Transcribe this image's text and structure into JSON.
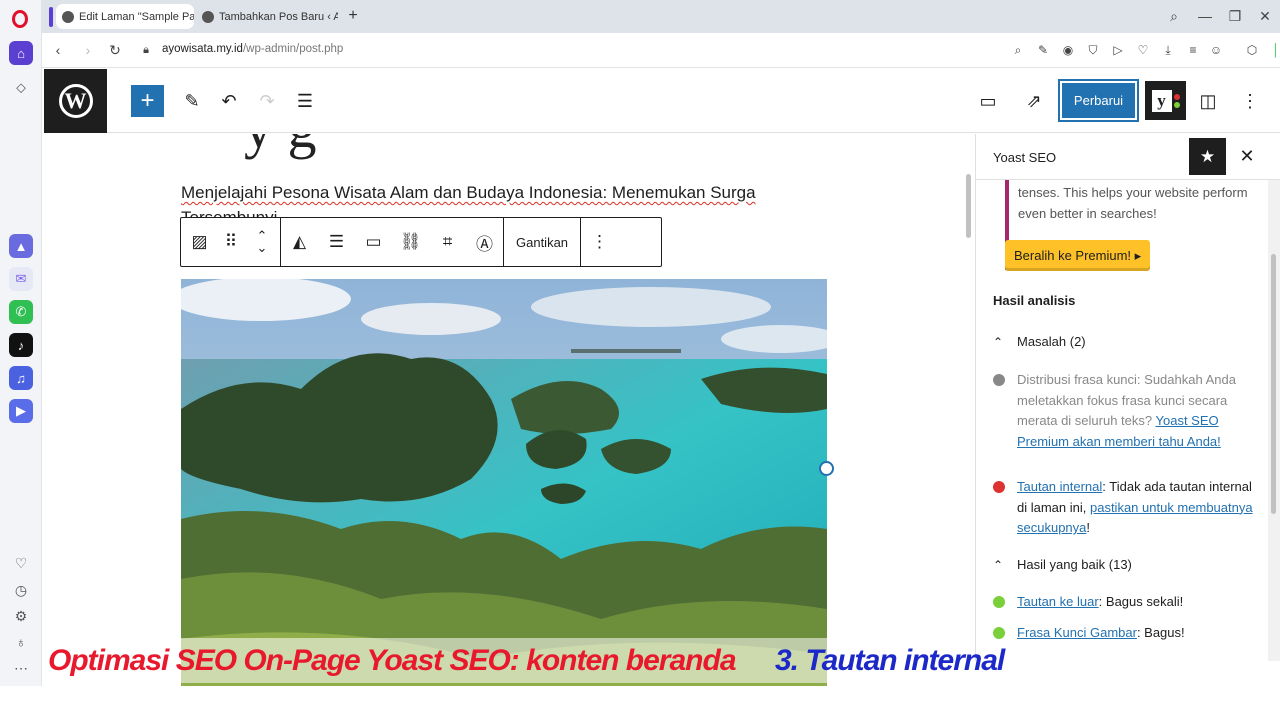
{
  "browser": {
    "tabs": [
      {
        "label": "Edit Laman \"Sample Page",
        "active": true
      },
      {
        "label": "Tambahkan Pos Baru ‹ Ayo",
        "active": false
      }
    ],
    "new_tab_icon": "plus-icon",
    "url_domain": "ayowisata.my.id",
    "url_path": "/wp-admin/post.php"
  },
  "editor": {
    "partial_heading": "y g",
    "paragraph": "Menjelajahi Pesona Wisata Alam dan Budaya Indonesia: Menemukan Surga Tersembunyi",
    "block_toolbar": {
      "replace_label": "Gantikan"
    },
    "image_alt": "Pemandangan pulau-pulau karst di laut biru kehijauan"
  },
  "toolbar": {
    "update_label": "Perbarui",
    "yoast_letter": "y"
  },
  "sidebar": {
    "title": "Yoast SEO",
    "premium_text": "tenses. This helps your website perform even better in searches!",
    "premium_button": "Beralih ke Premium! ▸",
    "analysis_title": "Hasil analisis",
    "problems_heading": "Masalah (2)",
    "problems": [
      {
        "status": "gray",
        "text": "Distribusi frasa kunci: Sudahkah Anda meletakkan fokus frasa kunci secara merata di seluruh teks? ",
        "link": "Yoast SEO Premium akan memberi tahu Anda!"
      },
      {
        "status": "red",
        "link": "Tautan internal",
        "text": ": Tidak ada tautan internal di laman ini, ",
        "link2": "pastikan untuk membuatnya secukupnya",
        "tail": "!"
      }
    ],
    "good_heading": "Hasil yang baik (13)",
    "good": [
      {
        "link": "Tautan ke luar",
        "text": ": Bagus sekali!"
      },
      {
        "link": "Frasa Kunci Gambar",
        "text": ": Bagus!"
      }
    ]
  },
  "caption": {
    "left": "Optimasi SEO On-Page Yoast SEO: konten beranda",
    "right": "3. Tautan internal"
  },
  "colors": {
    "wp_blue": "#2271b1",
    "yoast_purple": "#a4286a",
    "premium_yellow": "#fec228",
    "status_red": "#dc3232",
    "status_green": "#7ad03a",
    "status_gray": "#888888",
    "caption_red": "#e8182d",
    "caption_blue": "#1c28c7"
  }
}
